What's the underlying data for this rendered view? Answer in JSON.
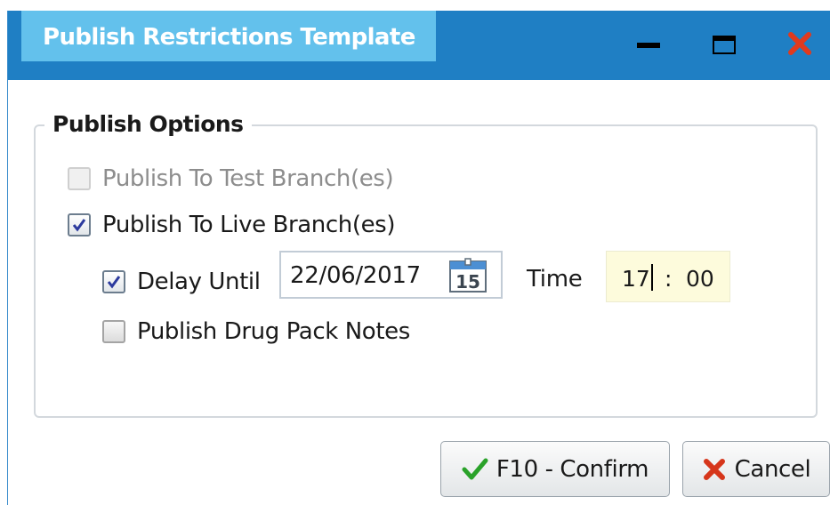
{
  "window": {
    "title": "Publish Restrictions Template",
    "controls": {
      "minimize": "minimize-icon",
      "maximize": "maximize-icon",
      "close": "close-icon"
    },
    "close_color": "#e03a1e",
    "titlebar_color": "#1f7fc4",
    "title_tab_color": "#63c1ec"
  },
  "publish_options": {
    "title": "Publish Options",
    "test_branches": {
      "label": "Publish To Test Branch(es)",
      "checked": false,
      "enabled": false
    },
    "live_branches": {
      "label": "Publish To Live Branch(es)",
      "checked": true,
      "enabled": true
    },
    "delay_until": {
      "label": "Delay Until",
      "checked": true,
      "date": "22/06/2017",
      "calendar_day": "15"
    },
    "time": {
      "label": "Time",
      "hour": "17",
      "separator": ":",
      "minute": "00"
    },
    "drug_pack_notes": {
      "label": "Publish Drug Pack Notes",
      "checked": false
    }
  },
  "buttons": {
    "confirm": {
      "label": "F10 - Confirm",
      "icon": "checkmark-icon",
      "icon_color": "#2aa22a"
    },
    "cancel": {
      "label": "Cancel",
      "icon": "cross-icon",
      "icon_color": "#d6361b"
    }
  }
}
